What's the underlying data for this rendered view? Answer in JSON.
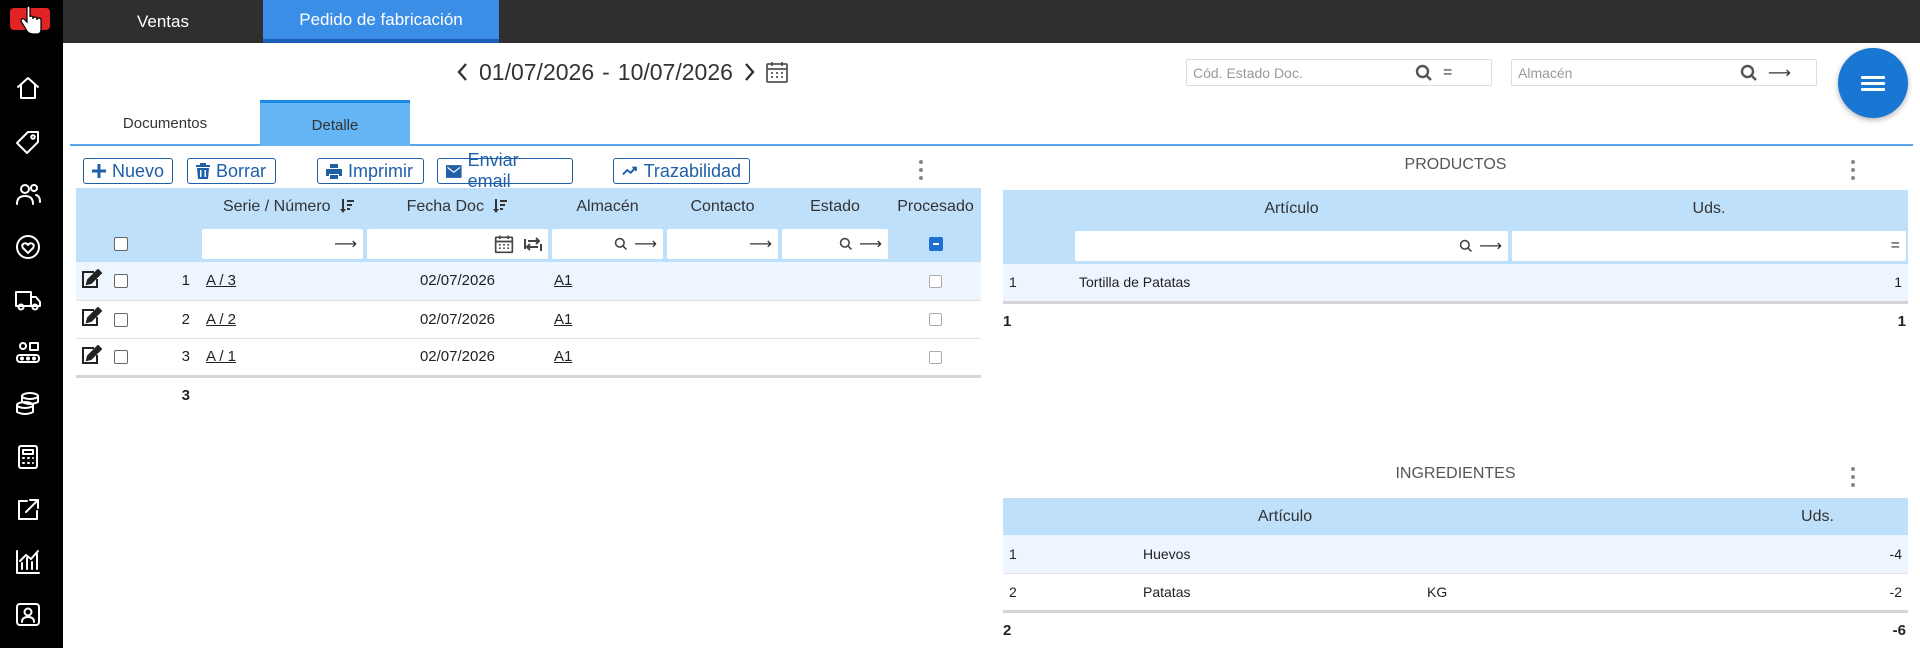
{
  "top_tabs": [
    {
      "label": "Ventas"
    },
    {
      "label": "Pedido de fabricación"
    }
  ],
  "date_range": {
    "from": "01/07/2026",
    "separator": "-",
    "to": "10/07/2026"
  },
  "filters": {
    "estado": {
      "placeholder": "Cód. Estado Doc.",
      "operator": "="
    },
    "almacen": {
      "placeholder": "Almacén",
      "operator": "⟶"
    }
  },
  "sub_tabs": [
    {
      "label": "Documentos",
      "active": false
    },
    {
      "label": "Detalle",
      "active": true
    }
  ],
  "toolbar": {
    "nuevo": "Nuevo",
    "borrar": "Borrar",
    "imprimir": "Imprimir",
    "enviar_email": "Enviar email",
    "trazabilidad": "Trazabilidad"
  },
  "documents": {
    "columns": {
      "serie": "Serie / Número",
      "fecha": "Fecha Doc",
      "almacen": "Almacén",
      "contacto": "Contacto",
      "estado": "Estado",
      "procesado": "Procesado"
    },
    "filter_ops": {
      "serie": "⟶",
      "almacen": "⟶",
      "contacto": "⟶",
      "estado": "⟶"
    },
    "rows": [
      {
        "num": "1",
        "serie": "A / 3",
        "fecha": "02/07/2026",
        "almacen": "A1",
        "contacto": "",
        "estado": ""
      },
      {
        "num": "2",
        "serie": "A / 2",
        "fecha": "02/07/2026",
        "almacen": "A1",
        "contacto": "",
        "estado": ""
      },
      {
        "num": "3",
        "serie": "A / 1",
        "fecha": "02/07/2026",
        "almacen": "A1",
        "contacto": "",
        "estado": ""
      }
    ],
    "total": "3"
  },
  "productos": {
    "title": "PRODUCTOS",
    "columns": {
      "articulo": "Artículo",
      "uds": "Uds."
    },
    "filter_ops": {
      "articulo": "⟶",
      "uds": "="
    },
    "rows": [
      {
        "num": "1",
        "articulo": "Tortilla de Patatas",
        "uds": "1"
      }
    ],
    "footer": {
      "count": "1",
      "uds": "1"
    }
  },
  "ingredientes": {
    "title": "INGREDIENTES",
    "columns": {
      "articulo": "Artículo",
      "uds": "Uds."
    },
    "rows": [
      {
        "num": "1",
        "articulo": "Huevos",
        "unidad": "",
        "uds": "-4"
      },
      {
        "num": "2",
        "articulo": "Patatas",
        "unidad": "KG",
        "uds": "-2"
      }
    ],
    "footer": {
      "count": "2",
      "uds": "-6"
    }
  },
  "colors": {
    "accent": "#3a8ee6",
    "header_bg": "#bfe0fb",
    "fab": "#1976d2",
    "button": "#1e5fa8"
  }
}
